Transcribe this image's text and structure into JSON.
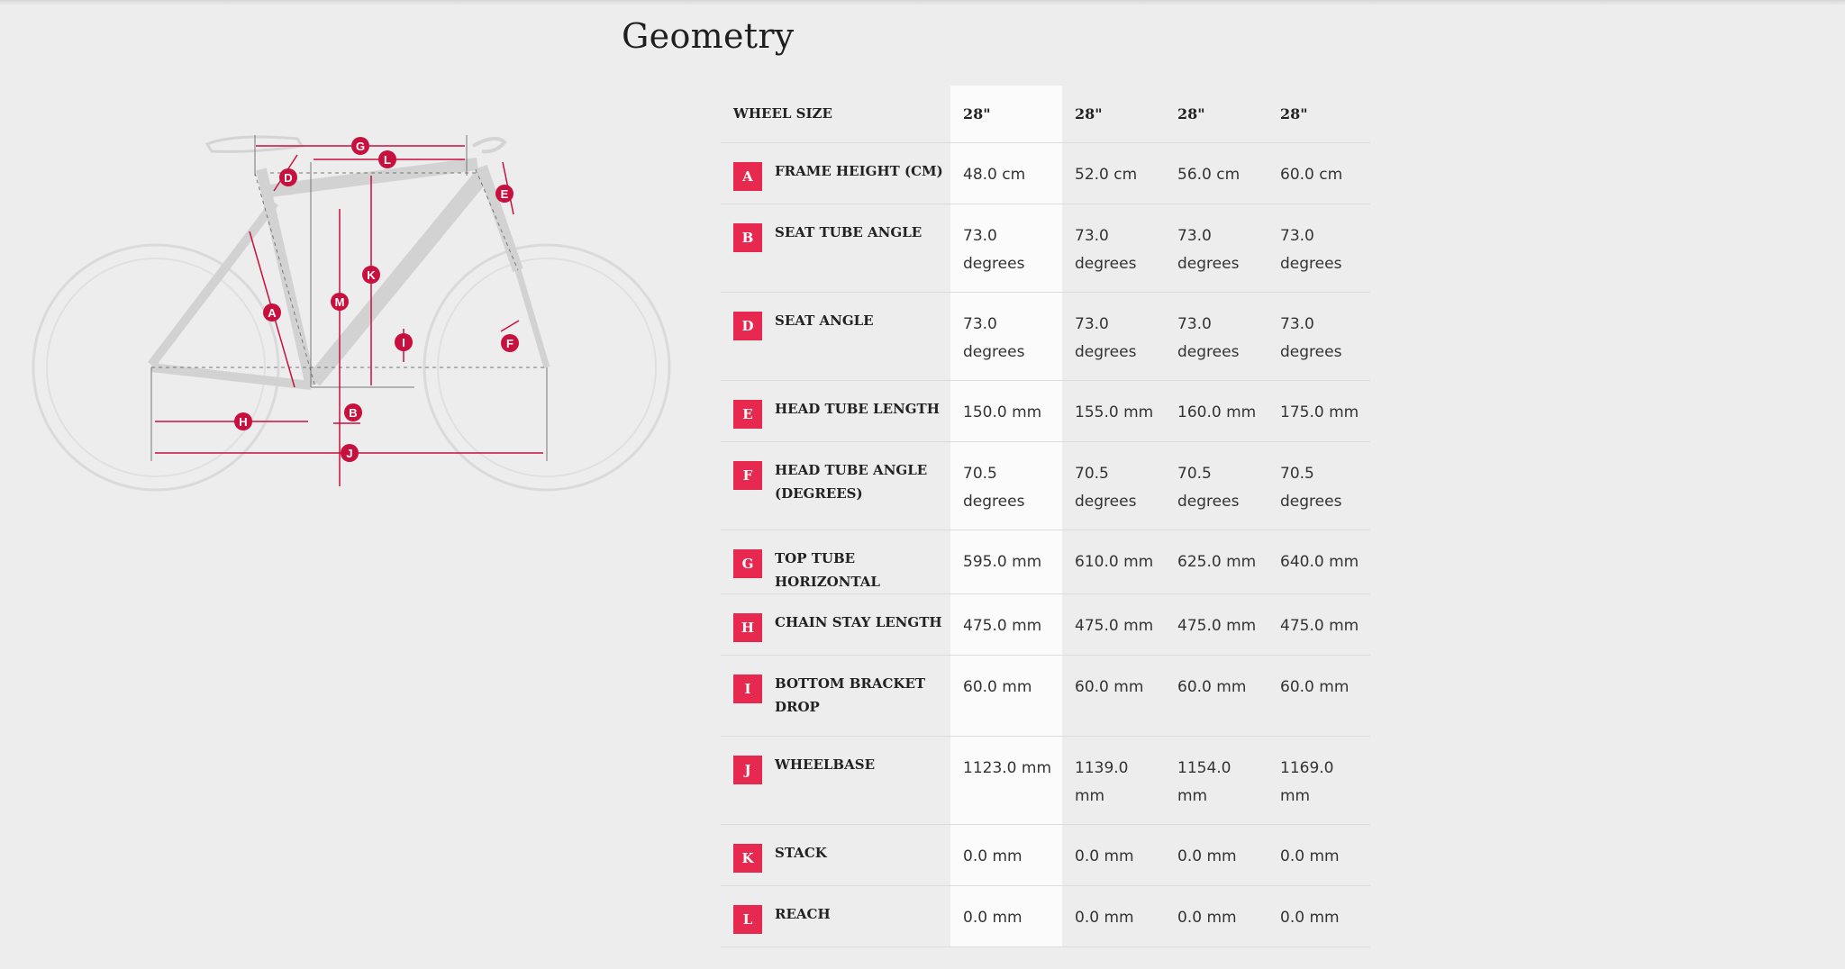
{
  "page": {
    "title": "Geometry"
  },
  "diagram": {
    "labels": [
      "A",
      "B",
      "D",
      "E",
      "F",
      "G",
      "H",
      "I",
      "J",
      "K",
      "L",
      "M"
    ],
    "accent_color": "#c8103e"
  },
  "table": {
    "header_label": "WHEEL SIZE",
    "sizes": [
      "28\"",
      "28\"",
      "28\"",
      "28\""
    ],
    "rows": [
      {
        "letter": "A",
        "label": "FRAME HEIGHT (CM)",
        "values": [
          "48.0 cm",
          "52.0 cm",
          "56.0 cm",
          "60.0 cm"
        ]
      },
      {
        "letter": "B",
        "label": "SEAT TUBE ANGLE",
        "values": [
          "73.0 degrees",
          "73.0 degrees",
          "73.0 degrees",
          "73.0 degrees"
        ]
      },
      {
        "letter": "D",
        "label": "SEAT ANGLE",
        "values": [
          "73.0 degrees",
          "73.0 degrees",
          "73.0 degrees",
          "73.0 degrees"
        ]
      },
      {
        "letter": "E",
        "label": "HEAD TUBE LENGTH",
        "values": [
          "150.0 mm",
          "155.0 mm",
          "160.0 mm",
          "175.0 mm"
        ]
      },
      {
        "letter": "F",
        "label": "HEAD TUBE ANGLE (DEGREES)",
        "values": [
          "70.5 degrees",
          "70.5 degrees",
          "70.5 degrees",
          "70.5 degrees"
        ]
      },
      {
        "letter": "G",
        "label": "TOP TUBE HORIZONTAL",
        "values": [
          "595.0 mm",
          "610.0 mm",
          "625.0 mm",
          "640.0 mm"
        ]
      },
      {
        "letter": "H",
        "label": "CHAIN STAY LENGTH",
        "values": [
          "475.0 mm",
          "475.0 mm",
          "475.0 mm",
          "475.0 mm"
        ]
      },
      {
        "letter": "I",
        "label": "BOTTOM BRACKET DROP",
        "values": [
          "60.0 mm",
          "60.0 mm",
          "60.0 mm",
          "60.0 mm"
        ]
      },
      {
        "letter": "J",
        "label": "WHEELBASE",
        "values": [
          "1123.0 mm",
          "1139.0 mm",
          "1154.0 mm",
          "1169.0 mm"
        ]
      },
      {
        "letter": "K",
        "label": "STACK",
        "values": [
          "0.0 mm",
          "0.0 mm",
          "0.0 mm",
          "0.0 mm"
        ]
      },
      {
        "letter": "L",
        "label": "REACH",
        "values": [
          "0.0 mm",
          "0.0 mm",
          "0.0 mm",
          "0.0 mm"
        ]
      }
    ]
  }
}
